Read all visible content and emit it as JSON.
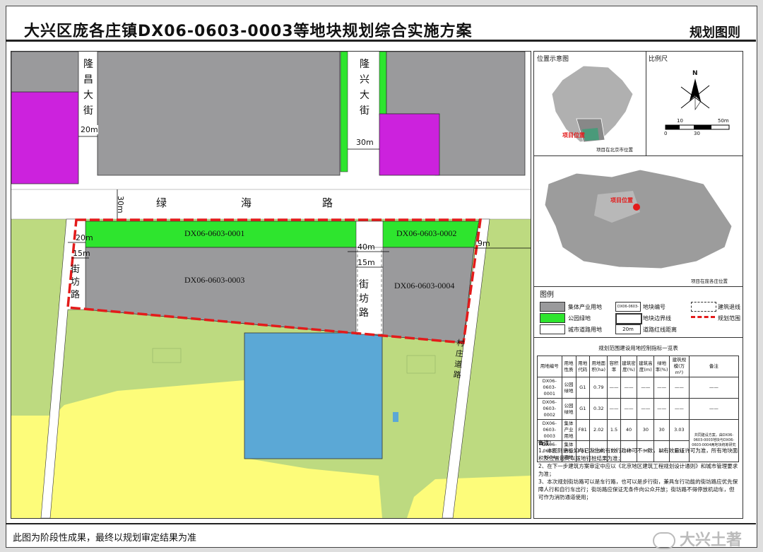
{
  "header": {
    "title": "大兴区庞各庄镇DX06-0603-0003等地块规划综合实施方案",
    "subtitle": "规划图则"
  },
  "map": {
    "roads": {
      "longchang": "隆昌大街",
      "longxing": "隆兴大街",
      "lvhai": [
        "绿",
        "海",
        "路"
      ],
      "jiefang_left": "街坊路",
      "jiefang_mid": "街坊路",
      "cunzhuang": "村庄道路"
    },
    "dims": {
      "d20_top": "20m",
      "d30_top": "30m",
      "d30_lvhai": "30m",
      "d20_left": "20m",
      "d15_left": "15m",
      "d40": "40m",
      "d15_mid": "15m",
      "d9": "9m"
    },
    "parcels": {
      "p1": "DX06-0603-0001",
      "p2": "DX06-0603-0002",
      "p3": "DX06-0603-0003",
      "p4": "DX06-0603-0004"
    }
  },
  "side": {
    "loc_title": "位置示意图",
    "loc_marker": "项目位置",
    "loc_caption": "项目在北京市位置",
    "scale_title": "比例尺",
    "scale_ticks": [
      "0",
      "10",
      "30",
      "50m"
    ],
    "north": "N",
    "town_marker": "项目位置",
    "town_caption": "项目在庞各庄位置",
    "legend_title": "图例",
    "legend": [
      "集体产业用地",
      "公园绿地",
      "城市道路用地",
      "地块编号",
      "地块边界线",
      "道路红线距离",
      "建筑退线",
      "规划范围"
    ],
    "legend_code": "DX06-0603-0001",
    "legend_dist": "20m",
    "table_title": "规划范围建设用地控制指标一览表",
    "table_head": [
      "用地编号",
      "用地性质",
      "用地代码",
      "用地面积(ha)",
      "容积率",
      "建筑密度(%)",
      "建筑高度(m)",
      "绿地率(%)",
      "建筑规模(万m²)",
      "备注"
    ],
    "table_rows": [
      [
        "DX06-0603-0001",
        "公园绿地",
        "G1",
        "0.79",
        "——",
        "——",
        "——",
        "——",
        "——",
        "——"
      ],
      [
        "DX06-0603-0002",
        "公园绿地",
        "G1",
        "0.32",
        "——",
        "——",
        "——",
        "——",
        "——",
        "——"
      ],
      [
        "DX06-0603-0003",
        "集体产业用地",
        "F81",
        "2.02",
        "1.5",
        "40",
        "30",
        "30",
        "3.03",
        "共同建设方案，由DX06-0603-0003地块与DX06-0603-0004两地块统筹研究"
      ],
      [
        "DX06-0603-0004",
        "集体产业用地",
        "F81",
        "0.90",
        "1.5",
        "40",
        "30",
        "30",
        "1.35",
        ""
      ]
    ],
    "notes": [
      "备注：",
      "1、本图则指标如与已发生的有效行政许可不一致，以有效量证许可为准，所有地块面积及位置最终以拨地钉桩结果为准；",
      "2、在下一步建筑方案审定中应以《北京地区建筑工程规划设计通则》和城市管理要求为准；",
      "3、本次规划街坊路可以是车行路，也可以是步行街，兼具车行功能的街坊路应优先保障人行和自行车出行；街坊路应保证无条件向公众开放；街坊路不得停放机动车，但可作为消防通道使用；"
    ]
  },
  "footer": {
    "note": "此图为阶段性成果，最终以规划审定结果为准",
    "watermark": "大兴土著"
  },
  "colors": {
    "gray": "#9a9a9c",
    "green": "#2ee52e",
    "purple": "#cc22dd",
    "blue": "#5ba8d6",
    "yellow": "#fdfc7a",
    "lightgreen": "#bdda80",
    "red": "#e31b1b"
  }
}
